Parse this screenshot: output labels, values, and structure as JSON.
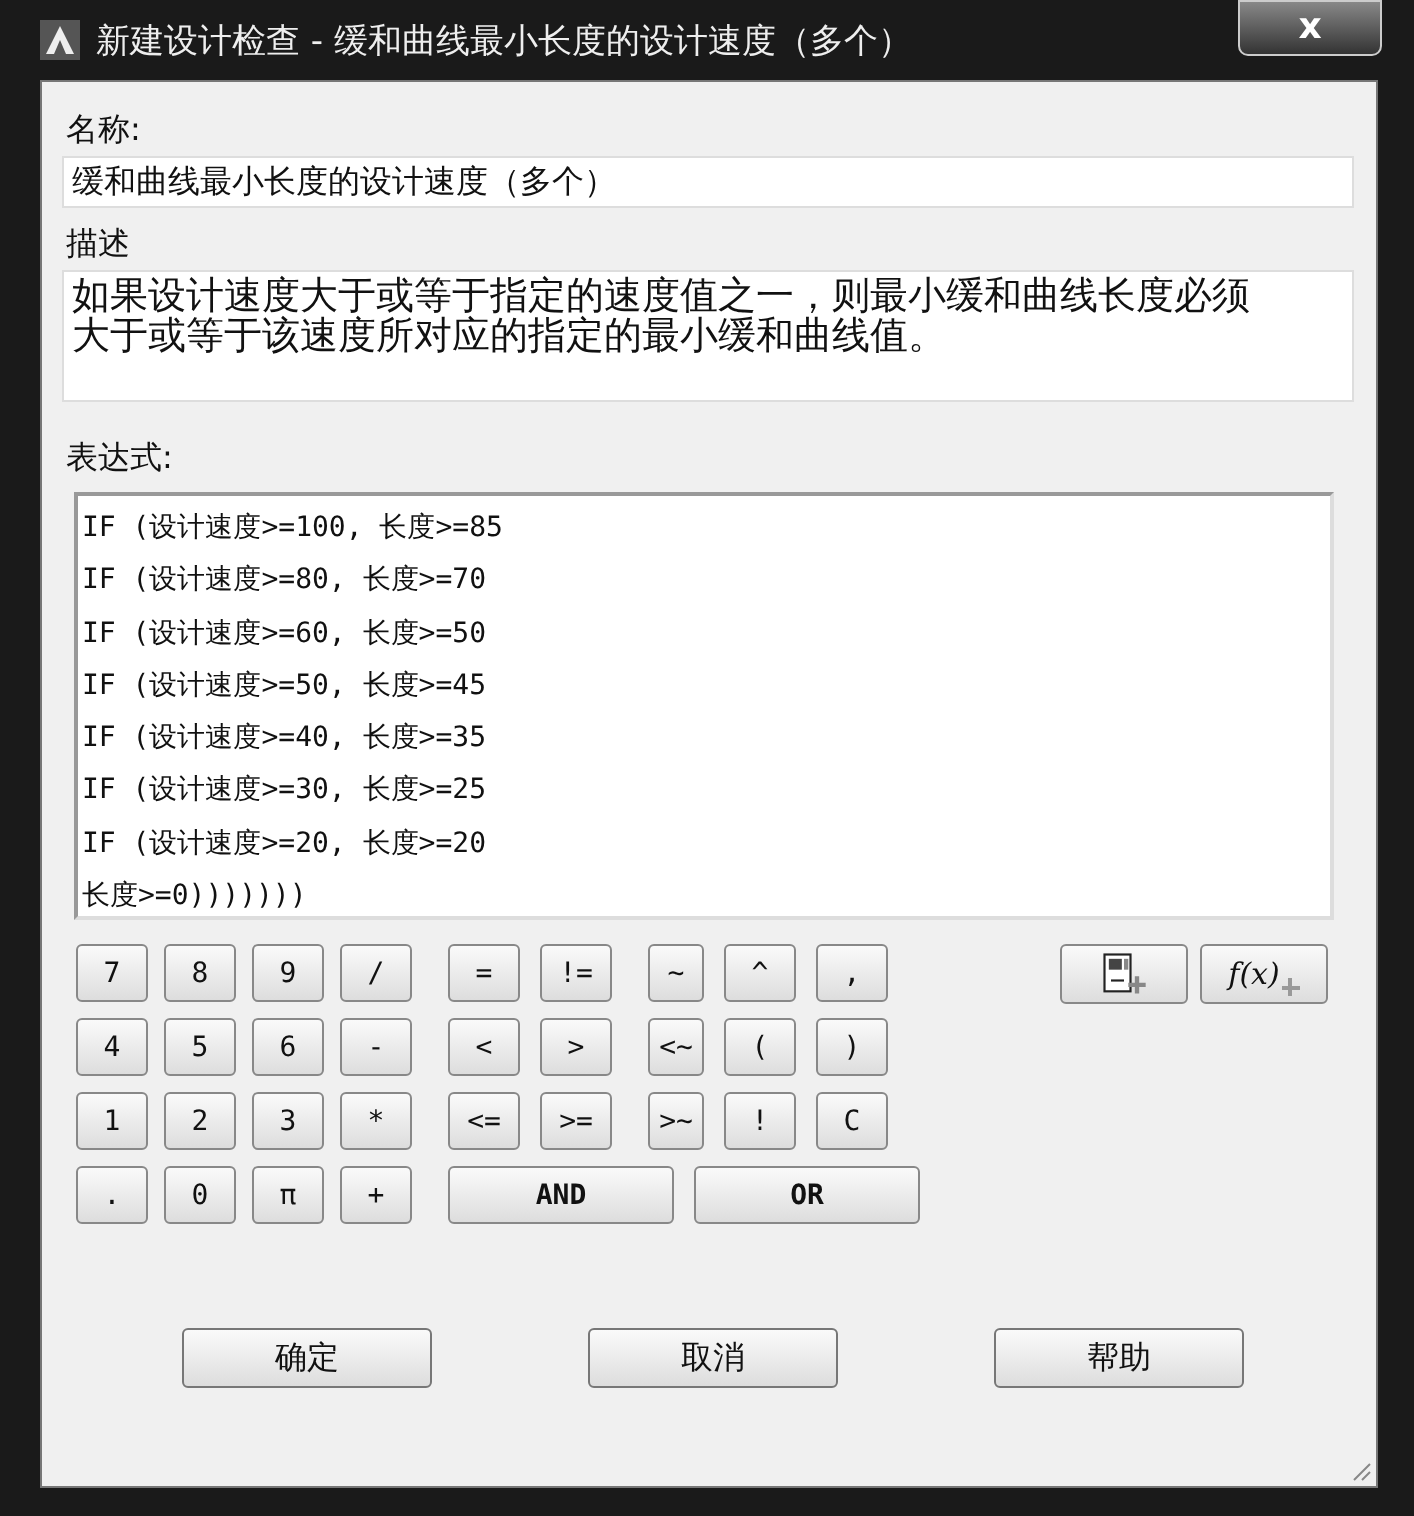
{
  "window": {
    "title": "新建设计检查 - 缓和曲线最小长度的设计速度（多个）",
    "close": "x"
  },
  "name": {
    "label": "名称:",
    "value": "缓和曲线最小长度的设计速度（多个）"
  },
  "description": {
    "label": "描述",
    "value": "如果设计速度大于或等于指定的速度值之一，则最小缓和曲线长度必须大于或等于该速度所对应的指定的最小缓和曲线值。"
  },
  "expression": {
    "label": "表达式:",
    "lines": [
      "IF (设计速度>=100, 长度>=85",
      "IF (设计速度>=80, 长度>=70",
      "IF (设计速度>=60, 长度>=50",
      "IF (设计速度>=50, 长度>=45",
      "IF (设计速度>=40, 长度>=35",
      "IF (设计速度>=30, 长度>=25",
      "IF (设计速度>=20, 长度>=20",
      "长度>=0)))))))"
    ]
  },
  "number_keys": [
    "7",
    "8",
    "9",
    "/",
    "4",
    "5",
    "6",
    "-",
    "1",
    "2",
    "3",
    "*",
    ".",
    "0",
    "π",
    "+"
  ],
  "operator_keys": [
    "=",
    "!=",
    "~",
    "^",
    ",",
    "<",
    ">",
    "<~",
    "(",
    ")",
    "<=",
    ">=",
    ">~",
    "!",
    "C"
  ],
  "logic_keys": [
    "AND",
    "OR"
  ],
  "tool_buttons": [
    {
      "kind": "property"
    },
    {
      "kind": "function",
      "label": "f(x)"
    }
  ],
  "buttons": [
    "确定",
    "取消",
    "帮助"
  ]
}
